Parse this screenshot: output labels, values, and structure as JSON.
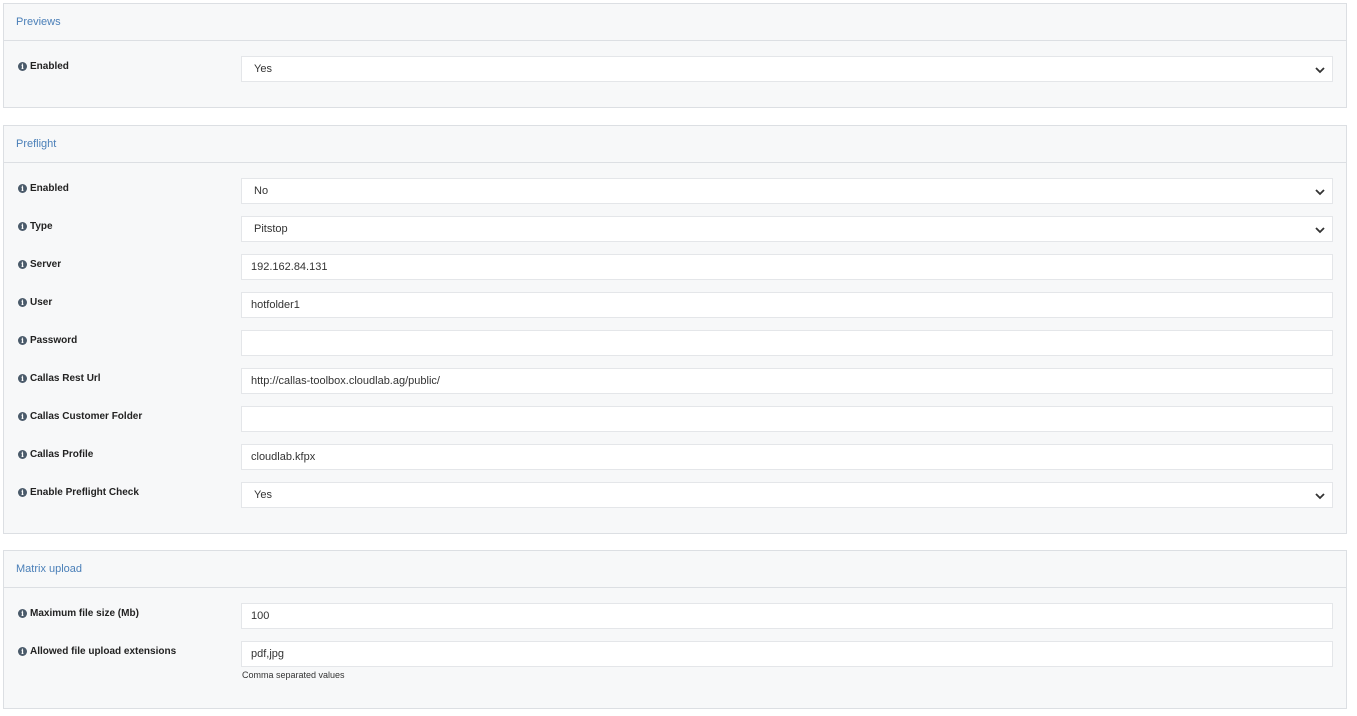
{
  "sections": {
    "previews": {
      "title": "Previews",
      "fields": {
        "enabled": {
          "label": "Enabled",
          "value": "Yes"
        }
      }
    },
    "preflight": {
      "title": "Preflight",
      "fields": {
        "enabled": {
          "label": "Enabled",
          "value": "No"
        },
        "type": {
          "label": "Type",
          "value": "Pitstop"
        },
        "server": {
          "label": "Server",
          "value": "192.162.84.131"
        },
        "user": {
          "label": "User",
          "value": "hotfolder1"
        },
        "password": {
          "label": "Password",
          "value": ""
        },
        "callas_rest_url": {
          "label": "Callas Rest Url",
          "value": "http://callas-toolbox.cloudlab.ag/public/"
        },
        "callas_customer_folder": {
          "label": "Callas Customer Folder",
          "value": ""
        },
        "callas_profile": {
          "label": "Callas Profile",
          "value": "cloudlab.kfpx"
        },
        "enable_preflight_check": {
          "label": "Enable Preflight Check",
          "value": "Yes"
        }
      }
    },
    "matrix_upload": {
      "title": "Matrix upload",
      "fields": {
        "max_file_size": {
          "label": "Maximum file size (Mb)",
          "value": "100"
        },
        "allowed_extensions": {
          "label": "Allowed file upload extensions",
          "value": "pdf,jpg",
          "help": "Comma separated values"
        }
      }
    }
  },
  "icons": {
    "info": "info-circle-icon",
    "dropdown": "chevron-down-icon"
  },
  "colors": {
    "header_text": "#4a7fb8",
    "panel_bg": "#f7f8f9",
    "border": "#dcdfe3"
  }
}
